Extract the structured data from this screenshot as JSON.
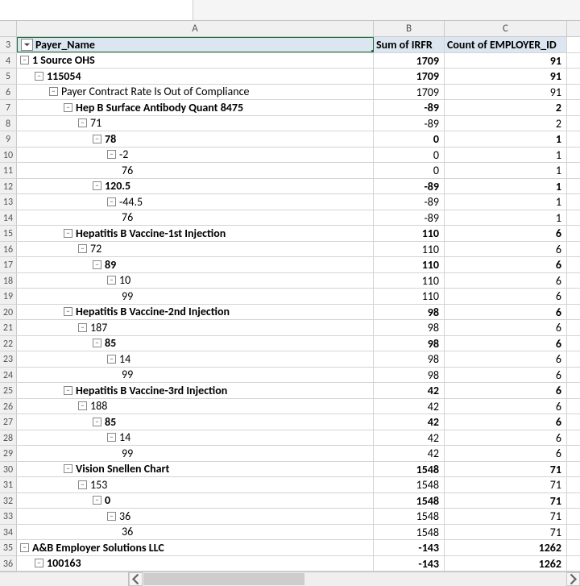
{
  "columns": {
    "A": "A",
    "B": "B",
    "C": "C"
  },
  "headers": {
    "A": "Payer_Name",
    "B": "Sum of IRFR",
    "C": "Count of EMPLOYER_ID"
  },
  "rows": [
    {
      "num": 3,
      "hdr": true
    },
    {
      "num": 4,
      "indent": 0,
      "exp": true,
      "label": "1 Source OHS",
      "b": "1709",
      "c": "91",
      "bold": true
    },
    {
      "num": 5,
      "indent": 1,
      "exp": true,
      "label": "115054",
      "b": "1709",
      "c": "91",
      "bold": true
    },
    {
      "num": 6,
      "indent": 2,
      "exp": true,
      "label": "Payer Contract Rate Is Out of Compliance",
      "b": "1709",
      "c": "91"
    },
    {
      "num": 7,
      "indent": 3,
      "exp": true,
      "label": "Hep B Surface Antibody Quant 8475",
      "b": "-89",
      "c": "2",
      "bold": true
    },
    {
      "num": 8,
      "indent": 4,
      "exp": true,
      "label": "71",
      "b": "-89",
      "c": "2"
    },
    {
      "num": 9,
      "indent": 5,
      "exp": true,
      "label": "78",
      "b": "0",
      "c": "1",
      "bold": true
    },
    {
      "num": 10,
      "indent": 6,
      "exp": true,
      "label": "-2",
      "b": "0",
      "c": "1"
    },
    {
      "num": 11,
      "indent": 7,
      "exp": false,
      "label": "76",
      "b": "0",
      "c": "1"
    },
    {
      "num": 12,
      "indent": 5,
      "exp": true,
      "label": "120.5",
      "b": "-89",
      "c": "1",
      "bold": true
    },
    {
      "num": 13,
      "indent": 6,
      "exp": true,
      "label": "-44.5",
      "b": "-89",
      "c": "1"
    },
    {
      "num": 14,
      "indent": 7,
      "exp": false,
      "label": "76",
      "b": "-89",
      "c": "1"
    },
    {
      "num": 15,
      "indent": 3,
      "exp": true,
      "label": "Hepatitis B Vaccine-1st Injection",
      "b": "110",
      "c": "6",
      "bold": true
    },
    {
      "num": 16,
      "indent": 4,
      "exp": true,
      "label": "72",
      "b": "110",
      "c": "6"
    },
    {
      "num": 17,
      "indent": 5,
      "exp": true,
      "label": "89",
      "b": "110",
      "c": "6",
      "bold": true
    },
    {
      "num": 18,
      "indent": 6,
      "exp": true,
      "label": "10",
      "b": "110",
      "c": "6"
    },
    {
      "num": 19,
      "indent": 7,
      "exp": false,
      "label": "99",
      "b": "110",
      "c": "6"
    },
    {
      "num": 20,
      "indent": 3,
      "exp": true,
      "label": "Hepatitis B Vaccine-2nd Injection",
      "b": "98",
      "c": "6",
      "bold": true
    },
    {
      "num": 21,
      "indent": 4,
      "exp": true,
      "label": "187",
      "b": "98",
      "c": "6"
    },
    {
      "num": 22,
      "indent": 5,
      "exp": true,
      "label": "85",
      "b": "98",
      "c": "6",
      "bold": true
    },
    {
      "num": 23,
      "indent": 6,
      "exp": true,
      "label": "14",
      "b": "98",
      "c": "6"
    },
    {
      "num": 24,
      "indent": 7,
      "exp": false,
      "label": "99",
      "b": "98",
      "c": "6"
    },
    {
      "num": 25,
      "indent": 3,
      "exp": true,
      "label": "Hepatitis B Vaccine-3rd Injection",
      "b": "42",
      "c": "6",
      "bold": true
    },
    {
      "num": 26,
      "indent": 4,
      "exp": true,
      "label": "188",
      "b": "42",
      "c": "6"
    },
    {
      "num": 27,
      "indent": 5,
      "exp": true,
      "label": "85",
      "b": "42",
      "c": "6",
      "bold": true
    },
    {
      "num": 28,
      "indent": 6,
      "exp": true,
      "label": "14",
      "b": "42",
      "c": "6"
    },
    {
      "num": 29,
      "indent": 7,
      "exp": false,
      "label": "99",
      "b": "42",
      "c": "6"
    },
    {
      "num": 30,
      "indent": 3,
      "exp": true,
      "label": "Vision Snellen Chart",
      "b": "1548",
      "c": "71",
      "bold": true
    },
    {
      "num": 31,
      "indent": 4,
      "exp": true,
      "label": "153",
      "b": "1548",
      "c": "71"
    },
    {
      "num": 32,
      "indent": 5,
      "exp": true,
      "label": "0",
      "b": "1548",
      "c": "71",
      "bold": true
    },
    {
      "num": 33,
      "indent": 6,
      "exp": true,
      "label": "36",
      "b": "1548",
      "c": "71"
    },
    {
      "num": 34,
      "indent": 7,
      "exp": false,
      "label": "36",
      "b": "1548",
      "c": "71"
    },
    {
      "num": 35,
      "indent": 0,
      "exp": true,
      "label": "A&B Employer Solutions LLC",
      "b": "-143",
      "c": "1262",
      "bold": true
    },
    {
      "num": 36,
      "indent": 1,
      "exp": true,
      "label": "100163",
      "b": "-143",
      "c": "1262",
      "bold": true
    }
  ]
}
